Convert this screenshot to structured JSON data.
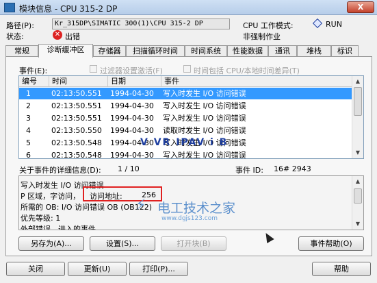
{
  "window": {
    "title": "模块信息 - CPU 315-2 DP",
    "close_label": "X"
  },
  "header": {
    "path_label": "路径(P):",
    "path_value": "Kr_315DP\\SIMATIC 300(1)\\CPU 315-2 DP",
    "status_label": "状态:",
    "status_value": "出错",
    "cpu_mode_label": "CPU 工作模式:",
    "cpu_mode_value": "RUN",
    "force_status": "非强制作业"
  },
  "tabs": [
    "常规",
    "诊断缓冲区",
    "存储器",
    "扫描循环时间",
    "时间系统",
    "性能数据",
    "通讯",
    "堆栈",
    "标识"
  ],
  "active_tab": "诊断缓冲区",
  "events": {
    "label": "事件(E):",
    "filter_label": "过滤器设置激活(F)",
    "time_label": "时间包括 CPU/本地时间差异(T)",
    "columns": [
      "编号",
      "时间",
      "日期",
      "事件"
    ],
    "rows": [
      {
        "no": "1",
        "time": "02:13:50.551",
        "date": "1994-04-30",
        "event": "写入时发生 I/O 访问错误"
      },
      {
        "no": "2",
        "time": "02:13:50.551",
        "date": "1994-04-30",
        "event": "写入时发生 I/O 访问错误"
      },
      {
        "no": "3",
        "time": "02:13:50.551",
        "date": "1994-04-30",
        "event": "写入时发生 I/O 访问错误"
      },
      {
        "no": "4",
        "time": "02:13:50.550",
        "date": "1994-04-30",
        "event": "读取时发生 I/O 访问错误"
      },
      {
        "no": "5",
        "time": "02:13:50.548",
        "date": "1994-04-30",
        "event": "写入时发生 I/O 访问错误"
      },
      {
        "no": "6",
        "time": "02:13:50.548",
        "date": "1994-04-30",
        "event": "写入时发生 I/O 访问错误"
      }
    ]
  },
  "detail": {
    "label": "关于事件的详细信息(D):",
    "counter": "1 / 10",
    "event_id_label": "事件 ID:",
    "event_id_value": "16# 2943",
    "lines": [
      "写入时发生 I/O 访问错误",
      "P 区域，字访问，",
      "所需的 OB: I/O 访问错误 OB (OB122)",
      "优先等级: 1",
      "外部错误，进入的事件"
    ],
    "address_label": "访问地址:",
    "address_value": "256"
  },
  "watermark": {
    "name": "电工技术之家",
    "url": "www.dgjs123.com"
  },
  "ghost_text": "V VR IPAV i B",
  "buttons": {
    "save_as": "另存为(A)...",
    "settings": "设置(S)...",
    "open_block": "打开块(B)",
    "event_help": "事件帮助(O)",
    "close": "关闭",
    "update": "更新(U)",
    "print": "打印(P)...",
    "help": "帮助"
  }
}
